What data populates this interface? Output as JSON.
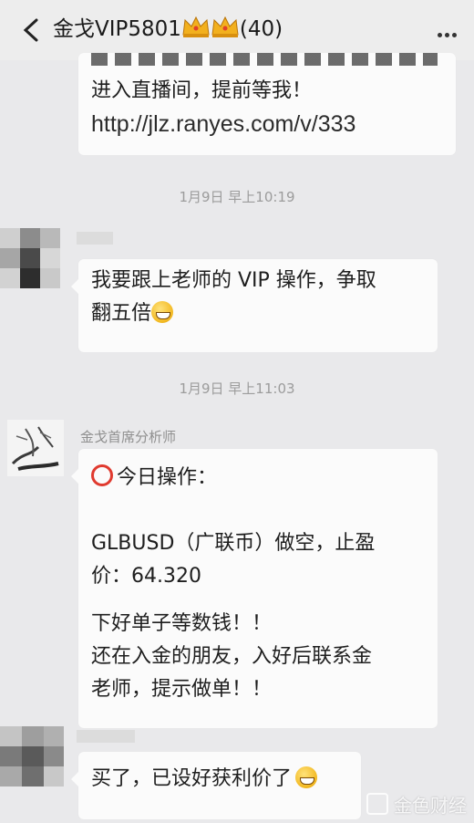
{
  "header": {
    "title": "金戈VIP5801",
    "member_count": "(40)"
  },
  "messages": {
    "m1": {
      "line1": "进入直播间，提前等我！",
      "link": "http://jlz.ranyes.com/v/333"
    },
    "ts1": "1月9日 早上10:19",
    "m2": {
      "line1": "我要跟上老师的 VIP 操作，争取",
      "line2": "翻五倍"
    },
    "ts2": "1月9日 早上11:03",
    "m3": {
      "sender": "金戈首席分析师",
      "line1": "今日操作：",
      "line2": "GLBUSD（广联币）做空，止盈",
      "line3": "价：64.320",
      "line4": "下好单子等数钱！！",
      "line5": "还在入金的朋友，入好后联系金",
      "line6": "老师，提示做单！！"
    },
    "m4": {
      "line1": "买了，已设好获利价了"
    }
  },
  "watermark": "金色财经",
  "colors": {
    "bubble": "#fbfbfb",
    "background": "#e9e9eb",
    "accent_circle": "#e03a2f"
  },
  "icons": [
    "back-icon",
    "crown-icon",
    "more-icon",
    "grin-emoji-icon",
    "red-circle-icon"
  ]
}
